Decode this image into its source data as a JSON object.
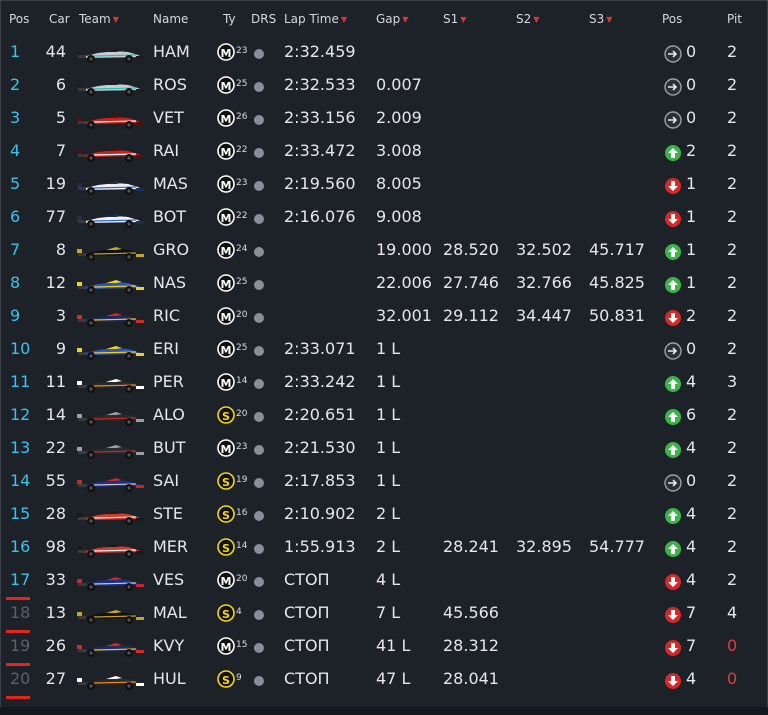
{
  "headers": {
    "pos": "Pos",
    "car": "Car",
    "team": "Team",
    "name": "Name",
    "tyre": "Ty",
    "drs": "DRS",
    "lap": "Lap Time",
    "gap": "Gap",
    "s1": "S1",
    "s2": "S2",
    "s3": "S3",
    "poschange": "Pos",
    "pit": "Pit"
  },
  "colors": {
    "accent_pos": "#39c3ea",
    "up": "#3bb54a",
    "down": "#d62828",
    "same": "#9aa0a8",
    "medium_tyre": "#ffffff",
    "soft_tyre": "#f5d90a",
    "pit_alert": "#e23b3b",
    "retired_marker": "#e0261d"
  },
  "rows": [
    {
      "pos": "1",
      "car": "44",
      "team": "mercedes",
      "name": "HAM",
      "tyre": "M",
      "tyre_age": "23",
      "lap": "2:32.459",
      "gap": "",
      "s1": "",
      "s2": "",
      "s3": "",
      "change": "same",
      "change_val": "0",
      "pit": "2"
    },
    {
      "pos": "2",
      "car": "6",
      "team": "mercedes",
      "name": "ROS",
      "tyre": "M",
      "tyre_age": "25",
      "lap": "2:32.533",
      "gap": "0.007",
      "s1": "",
      "s2": "",
      "s3": "",
      "change": "same",
      "change_val": "0",
      "pit": "2"
    },
    {
      "pos": "3",
      "car": "5",
      "team": "ferrari",
      "name": "VET",
      "tyre": "M",
      "tyre_age": "26",
      "lap": "2:33.156",
      "gap": "2.009",
      "s1": "",
      "s2": "",
      "s3": "",
      "change": "same",
      "change_val": "0",
      "pit": "2"
    },
    {
      "pos": "4",
      "car": "7",
      "team": "ferrari",
      "name": "RAI",
      "tyre": "M",
      "tyre_age": "22",
      "lap": "2:33.472",
      "gap": "3.008",
      "s1": "",
      "s2": "",
      "s3": "",
      "change": "up",
      "change_val": "2",
      "pit": "2"
    },
    {
      "pos": "5",
      "car": "19",
      "team": "williams",
      "name": "MAS",
      "tyre": "M",
      "tyre_age": "23",
      "lap": "2:19.560",
      "gap": "8.005",
      "s1": "",
      "s2": "",
      "s3": "",
      "change": "down",
      "change_val": "1",
      "pit": "2"
    },
    {
      "pos": "6",
      "car": "77",
      "team": "williams",
      "name": "BOT",
      "tyre": "M",
      "tyre_age": "22",
      "lap": "2:16.076",
      "gap": "9.008",
      "s1": "",
      "s2": "",
      "s3": "",
      "change": "down",
      "change_val": "1",
      "pit": "2"
    },
    {
      "pos": "7",
      "car": "8",
      "team": "lotus",
      "name": "GRO",
      "tyre": "M",
      "tyre_age": "24",
      "lap": "",
      "gap": "19.000",
      "s1": "28.520",
      "s2": "32.502",
      "s3": "45.717",
      "change": "up",
      "change_val": "1",
      "pit": "2"
    },
    {
      "pos": "8",
      "car": "12",
      "team": "sauber",
      "name": "NAS",
      "tyre": "M",
      "tyre_age": "25",
      "lap": "",
      "gap": "22.006",
      "s1": "27.746",
      "s2": "32.766",
      "s3": "45.825",
      "change": "up",
      "change_val": "1",
      "pit": "2"
    },
    {
      "pos": "9",
      "car": "3",
      "team": "redbull",
      "name": "RIC",
      "tyre": "M",
      "tyre_age": "20",
      "lap": "",
      "gap": "32.001",
      "s1": "29.112",
      "s2": "34.447",
      "s3": "50.831",
      "change": "down",
      "change_val": "2",
      "pit": "2"
    },
    {
      "pos": "10",
      "car": "9",
      "team": "sauber",
      "name": "ERI",
      "tyre": "M",
      "tyre_age": "25",
      "lap": "2:33.071",
      "gap": "1 L",
      "s1": "",
      "s2": "",
      "s3": "",
      "change": "same",
      "change_val": "0",
      "pit": "2"
    },
    {
      "pos": "11",
      "car": "11",
      "team": "forceindia",
      "name": "PER",
      "tyre": "M",
      "tyre_age": "14",
      "lap": "2:33.242",
      "gap": "1 L",
      "s1": "",
      "s2": "",
      "s3": "",
      "change": "up",
      "change_val": "4",
      "pit": "3"
    },
    {
      "pos": "12",
      "car": "14",
      "team": "mclaren",
      "name": "ALO",
      "tyre": "S",
      "tyre_age": "20",
      "lap": "2:20.651",
      "gap": "1 L",
      "s1": "",
      "s2": "",
      "s3": "",
      "change": "up",
      "change_val": "6",
      "pit": "2"
    },
    {
      "pos": "13",
      "car": "22",
      "team": "mclaren",
      "name": "BUT",
      "tyre": "M",
      "tyre_age": "23",
      "lap": "2:21.530",
      "gap": "1 L",
      "s1": "",
      "s2": "",
      "s3": "",
      "change": "up",
      "change_val": "4",
      "pit": "2"
    },
    {
      "pos": "14",
      "car": "55",
      "team": "tororosso",
      "name": "SAI",
      "tyre": "S",
      "tyre_age": "19",
      "lap": "2:17.853",
      "gap": "1 L",
      "s1": "",
      "s2": "",
      "s3": "",
      "change": "same",
      "change_val": "0",
      "pit": "2"
    },
    {
      "pos": "15",
      "car": "28",
      "team": "manor",
      "name": "STE",
      "tyre": "S",
      "tyre_age": "16",
      "lap": "2:10.902",
      "gap": "2 L",
      "s1": "",
      "s2": "",
      "s3": "",
      "change": "up",
      "change_val": "4",
      "pit": "2"
    },
    {
      "pos": "16",
      "car": "98",
      "team": "manor",
      "name": "MER",
      "tyre": "S",
      "tyre_age": "14",
      "lap": "1:55.913",
      "gap": "2 L",
      "s1": "28.241",
      "s2": "32.895",
      "s3": "54.777",
      "change": "up",
      "change_val": "4",
      "pit": "2"
    },
    {
      "pos": "17",
      "car": "33",
      "team": "tororosso",
      "name": "VES",
      "tyre": "M",
      "tyre_age": "20",
      "lap": "СТОП",
      "gap": "4 L",
      "s1": "",
      "s2": "",
      "s3": "",
      "change": "down",
      "change_val": "4",
      "pit": "2",
      "retired": true
    },
    {
      "pos": "18",
      "car": "13",
      "team": "lotus",
      "name": "MAL",
      "tyre": "S",
      "tyre_age": "4",
      "lap": "СТОП",
      "gap": "7 L",
      "s1": "45.566",
      "s2": "",
      "s3": "",
      "change": "down",
      "change_val": "7",
      "pit": "4",
      "retired": true,
      "dim": true
    },
    {
      "pos": "19",
      "car": "26",
      "team": "redbull",
      "name": "KVY",
      "tyre": "M",
      "tyre_age": "15",
      "lap": "СТОП",
      "gap": "41 L",
      "s1": "28.312",
      "s2": "",
      "s3": "",
      "change": "down",
      "change_val": "7",
      "pit": "0",
      "pit_alert": true,
      "retired": true,
      "dim": true
    },
    {
      "pos": "20",
      "car": "27",
      "team": "forceindia",
      "name": "HUL",
      "tyre": "S",
      "tyre_age": "9",
      "lap": "СТОП",
      "gap": "47 L",
      "s1": "28.041",
      "s2": "",
      "s3": "",
      "change": "down",
      "change_val": "4",
      "pit": "0",
      "pit_alert": true,
      "retired": true,
      "dim": true
    }
  ]
}
